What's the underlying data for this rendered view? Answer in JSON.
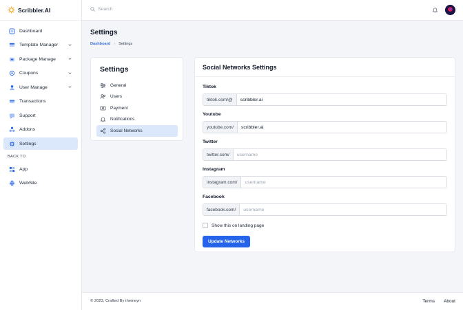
{
  "brand": {
    "name": "Scribbler.AI"
  },
  "search": {
    "placeholder": "Search"
  },
  "sidebar": {
    "items": [
      {
        "label": "Dashboard",
        "icon": "dashboard-icon"
      },
      {
        "label": "Template Manager",
        "icon": "template-icon"
      },
      {
        "label": "Package Manage",
        "icon": "package-icon"
      },
      {
        "label": "Coupons",
        "icon": "coupon-icon"
      },
      {
        "label": "User Manage",
        "icon": "user-icon"
      },
      {
        "label": "Transactions",
        "icon": "transactions-icon"
      },
      {
        "label": "Support",
        "icon": "support-icon"
      },
      {
        "label": "Addons",
        "icon": "addons-icon"
      },
      {
        "label": "Settings",
        "icon": "settings-icon"
      }
    ],
    "back_section": "BACK TO",
    "back_items": [
      {
        "label": "App",
        "icon": "app-icon"
      },
      {
        "label": "WebSite",
        "icon": "globe-icon"
      }
    ]
  },
  "page": {
    "title": "Settings",
    "breadcrumb": {
      "link": "Dashboard",
      "current": "Settings"
    }
  },
  "settings_menu": {
    "title": "Settings",
    "items": [
      {
        "label": "General",
        "icon": "sliders-icon"
      },
      {
        "label": "Users",
        "icon": "users-icon"
      },
      {
        "label": "Payment",
        "icon": "payment-icon"
      },
      {
        "label": "Notifications",
        "icon": "bell-icon"
      },
      {
        "label": "Social Networks",
        "icon": "share-icon"
      }
    ]
  },
  "form": {
    "title": "Social Networks Settings",
    "fields": [
      {
        "label": "Tiktok",
        "prefix": "tiktok.com/@",
        "value": "scribbler.ai",
        "placeholder": "username"
      },
      {
        "label": "Youtube",
        "prefix": "youtube.com/",
        "value": "scribbler.ai",
        "placeholder": "username"
      },
      {
        "label": "Twitter",
        "prefix": "twitter.com/",
        "value": "",
        "placeholder": "username"
      },
      {
        "label": "Instagram",
        "prefix": "instagram.com/",
        "value": "",
        "placeholder": "username"
      },
      {
        "label": "Facebook",
        "prefix": "facebook.com/",
        "value": "",
        "placeholder": "username"
      }
    ],
    "checkbox_label": "Show this on landing page",
    "submit_label": "Update Networks"
  },
  "footer": {
    "copyright": "© 2023, Crafted By themeyn",
    "terms": "Terms",
    "about": "About"
  },
  "colors": {
    "accent": "#2563eb",
    "active_bg": "#dbe7fb",
    "link": "#3b6fd1"
  }
}
